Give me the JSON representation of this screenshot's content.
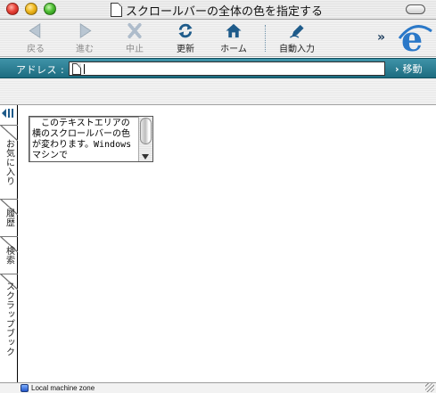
{
  "window": {
    "title": "スクロールバーの全体の色を指定する"
  },
  "toolbar": {
    "back_label": "戻る",
    "forward_label": "進む",
    "stop_label": "中止",
    "refresh_label": "更新",
    "home_label": "ホーム",
    "autofill_label": "自動入力",
    "overflow_label": "»"
  },
  "addressbar": {
    "label": "アドレス :",
    "value": "",
    "go_label": "移動"
  },
  "sidebar": {
    "tabs": [
      {
        "label": "お気に入り"
      },
      {
        "label": "履歴"
      },
      {
        "label": "検索"
      },
      {
        "label": "スクラップブック"
      }
    ]
  },
  "content": {
    "textarea_text": "　このテキストエリアの横のスクロールバーの色が変わります。Windowsマシンで"
  },
  "status": {
    "zone_text": "Local machine zone"
  },
  "colors": {
    "address_bar": "#2a7f93",
    "ie_blue": "#2a78c8",
    "toolbar_icon": "#1e5b8a"
  }
}
